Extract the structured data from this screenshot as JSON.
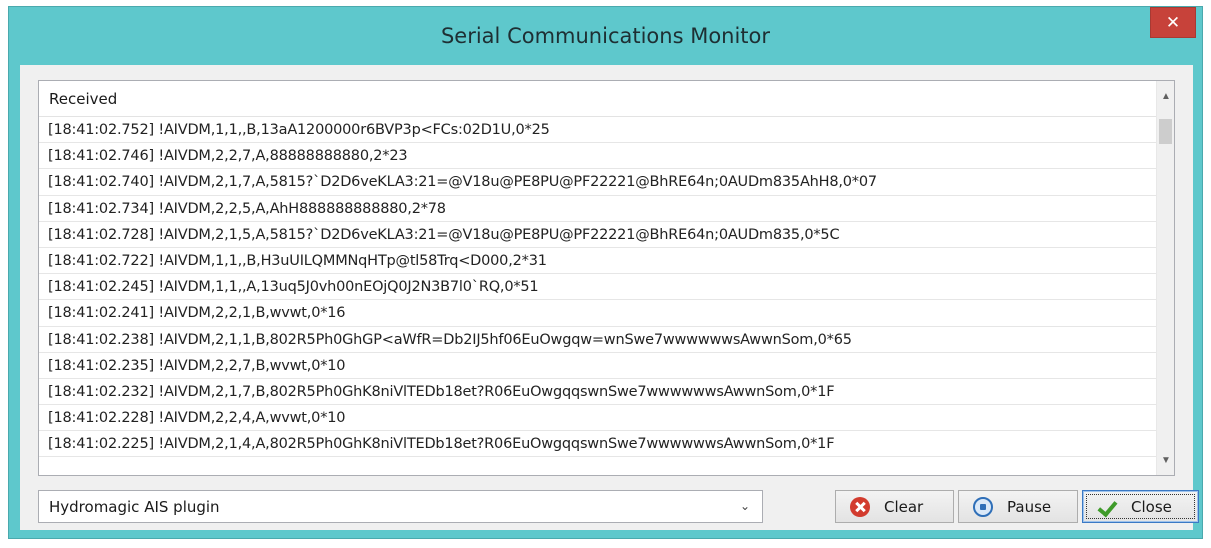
{
  "window": {
    "title": "Serial Communications Monitor",
    "close_glyph": "✕"
  },
  "log": {
    "header": "Received",
    "rows": [
      "[18:41:02.752] !AIVDM,1,1,,B,13aA1200000r6BVP3p<FCs:02D1U,0*25",
      "[18:41:02.746] !AIVDM,2,2,7,A,88888888880,2*23",
      "[18:41:02.740] !AIVDM,2,1,7,A,5815?`D2D6veKLA3:21=@V18u@PE8PU@PF22221@BhRE64n;0AUDm835AhH8,0*07",
      "[18:41:02.734] !AIVDM,2,2,5,A,AhH888888888880,2*78",
      "[18:41:02.728] !AIVDM,2,1,5,A,5815?`D2D6veKLA3:21=@V18u@PE8PU@PF22221@BhRE64n;0AUDm835,0*5C",
      "[18:41:02.722] !AIVDM,1,1,,B,H3uUILQMMNqHTp@tl58Trq<D000,2*31",
      "[18:41:02.245] !AIVDM,1,1,,A,13uq5J0vh00nEOjQ0J2N3B7l0`RQ,0*51",
      "[18:41:02.241] !AIVDM,2,2,1,B,wvwt,0*16",
      "[18:41:02.238] !AIVDM,2,1,1,B,802R5Ph0GhGP<aWfR=Db2IJ5hf06EuOwgqw=wnSwe7wwwwwwsAwwnSom,0*65",
      "[18:41:02.235] !AIVDM,2,2,7,B,wvwt,0*10",
      "[18:41:02.232] !AIVDM,2,1,7,B,802R5Ph0GhK8niVlTEDb18et?R06EuOwgqqswnSwe7wwwwwwsAwwnSom,0*1F",
      "[18:41:02.228] !AIVDM,2,2,4,A,wvwt,0*10",
      "[18:41:02.225] !AIVDM,2,1,4,A,802R5Ph0GhK8niVlTEDb18et?R06EuOwgqqswnSwe7wwwwwwsAwwnSom,0*1F"
    ]
  },
  "plugin_select": {
    "value": "Hydromagic AIS plugin"
  },
  "buttons": {
    "clear": "Clear",
    "pause": "Pause",
    "close": "Close"
  },
  "colors": {
    "frame": "#5ec8cc",
    "close_button": "#c7423a"
  }
}
